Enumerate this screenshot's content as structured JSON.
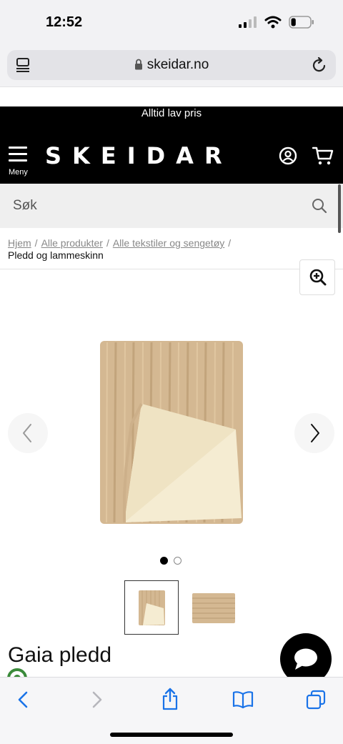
{
  "status_bar": {
    "time": "12:52",
    "battery_level": 0.25
  },
  "browser": {
    "url": "skeidar.no"
  },
  "header": {
    "promo": "Alltid lav pris",
    "menu_label": "Meny",
    "logo": "SKEIDAR"
  },
  "search": {
    "placeholder": "Søk"
  },
  "breadcrumb": {
    "items": [
      "Hjem",
      "Alle produkter",
      "Alle tekstiler og sengetøy"
    ],
    "separator": "/",
    "current": "Pledd og lammeskinn"
  },
  "gallery": {
    "image_count": 2,
    "active_index": 0
  },
  "product": {
    "title": "Gaia pledd"
  },
  "colors": {
    "brand_black": "#000000",
    "throw_fur": "#d4b892",
    "throw_lining": "#f5ecd2",
    "ios_blue": "#1a73e8"
  },
  "icons": {
    "status": [
      "signal-icon",
      "wifi-icon",
      "battery-icon"
    ],
    "browser": [
      "reader-icon",
      "lock-icon",
      "reload-icon"
    ],
    "header": [
      "menu-icon",
      "account-icon",
      "cart-icon"
    ],
    "toolbar": [
      "back-icon",
      "forward-icon",
      "share-icon",
      "bookmarks-icon",
      "tabs-icon"
    ]
  }
}
